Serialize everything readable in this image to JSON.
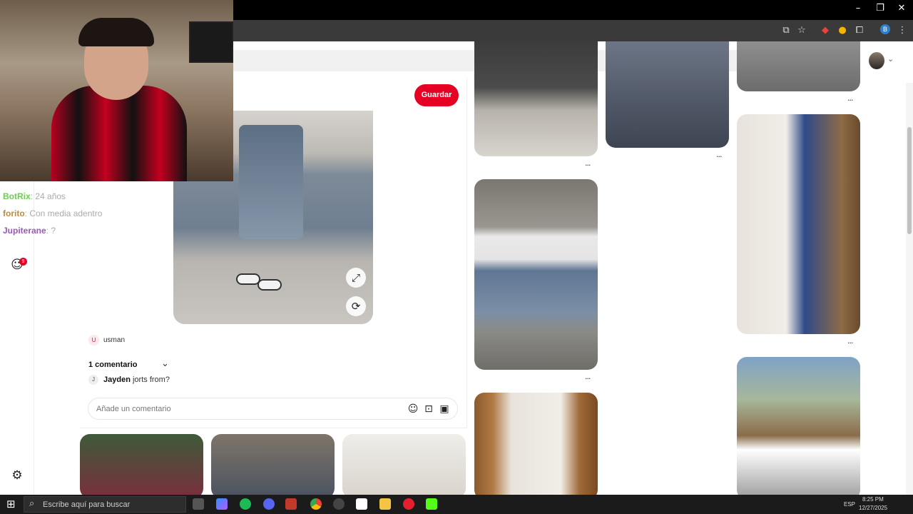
{
  "browser": {
    "window_controls": [
      "–",
      "❐",
      "✕"
    ]
  },
  "header": {
    "save_label": "Guardar"
  },
  "stream_chat": [
    {
      "user": "BotRix",
      "message": ": 24 años"
    },
    {
      "user": "forito",
      "message": ": Con media adentro"
    },
    {
      "user": "Jupiterane",
      "message": ": ?"
    }
  ],
  "rail": {
    "notifications_badge": "9",
    "chat_badge": "99+"
  },
  "pin": {
    "author_initial": "U",
    "author": "usman",
    "comments_header": "1 comentario",
    "comment_initial": "J",
    "comment_user": "Jayden",
    "comment_text": "jorts from?",
    "comment_placeholder": "Añade un comentario"
  },
  "more_label": "···",
  "taskbar": {
    "search_placeholder": "Escribe aquí para buscar",
    "language": "ESP",
    "time": "8:25 PM",
    "date": "12/27/2025"
  },
  "icons": {
    "minimize": "–",
    "restore": "❐",
    "close": "✕",
    "cast": "⧉",
    "star": "☆",
    "extensions": "⧠",
    "menu": "⋮",
    "chevron_down": "⌄",
    "expand": "⤢",
    "lens": "⟳",
    "emoji": "☺",
    "sticker": "⊡",
    "image": "▣",
    "chat": "☺",
    "settings": "⚙",
    "windows": "⊞",
    "search": "⌕"
  }
}
